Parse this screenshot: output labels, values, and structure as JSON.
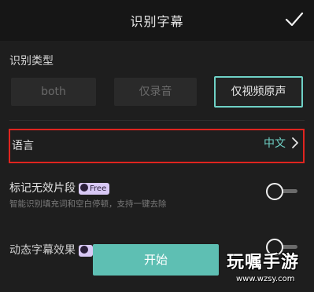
{
  "header": {
    "title": "识别字幕"
  },
  "recognition_type": {
    "label": "识别类型",
    "options": [
      {
        "label": "both",
        "selected": false
      },
      {
        "label": "仅录音",
        "selected": false
      },
      {
        "label": "仅视频原声",
        "selected": true
      }
    ]
  },
  "language": {
    "label": "语言",
    "value": "中文"
  },
  "mark_invalid": {
    "label": "标记无效片段",
    "badge": "Free",
    "description": "智能识别填充词和空白停顿，支持一键去除",
    "enabled": false
  },
  "dynamic_subtitle": {
    "label": "动态字幕效果",
    "enabled": false
  },
  "start_button": {
    "label": "开始"
  },
  "watermark": {
    "text": "玩嘱手游",
    "url": "www.wzsy.com"
  },
  "colors": {
    "accent": "#6fd1c6",
    "primary_button": "#5ebfb3",
    "highlight_border": "#e0241f",
    "background": "#1e1e1e"
  }
}
